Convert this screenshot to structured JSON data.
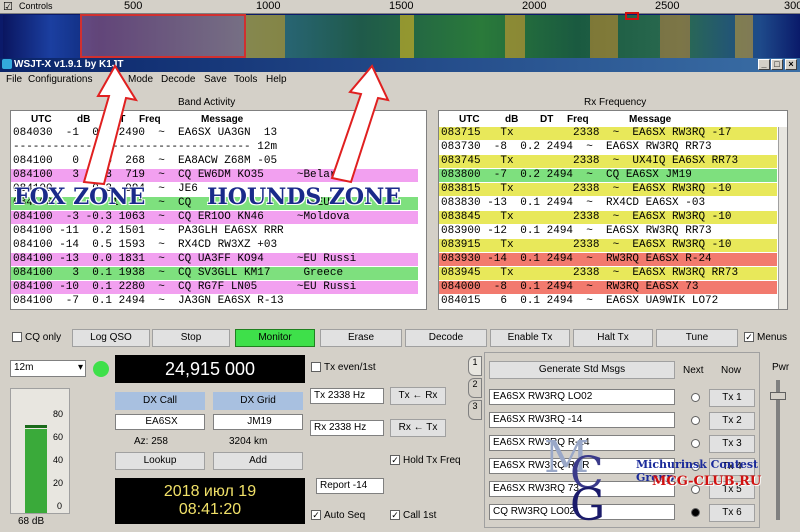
{
  "waterfall": {
    "controls_label": "Controls",
    "ticks": [
      "500",
      "1000",
      "1500",
      "2000",
      "2500",
      "300"
    ]
  },
  "window": {
    "title": "WSJT-X  v1.9.1   by K1JT"
  },
  "menu": [
    "File",
    "Configurations",
    "Mode",
    "Decode",
    "Save",
    "Tools",
    "Help"
  ],
  "band_activity": {
    "title": "Band Activity",
    "headers": {
      "utc": "UTC",
      "db": "dB",
      "dt": "DT",
      "freq": "Freq",
      "message": "Message"
    },
    "rows": [
      {
        "text": "084030  -1  0.2 2490  ~  EA6SX UA3GN  13",
        "color": "none"
      },
      {
        "text": "------------------------------------ 12m",
        "color": "none"
      },
      {
        "text": "084100   0  0.6  268  ~  EA8ACW Z68M -05",
        "color": "none"
      },
      {
        "text": "084100   3  0.3  719  ~  CQ EW6DM KO35     ~Belarus",
        "color": "pink"
      },
      {
        "text": "084100      0.3  994  ~  JE6",
        "color": "none"
      },
      {
        "text": "084100         1   1  ~  CQ                  ~EU",
        "color": "green"
      },
      {
        "text": "084100  -3 -0.3 1063  ~  CQ ER1OO KN46     ~Moldova",
        "color": "pink"
      },
      {
        "text": "084100 -11  0.2 1501  ~  PA3GLH EA6SX RRR",
        "color": "none"
      },
      {
        "text": "084100 -14  0.5 1593  ~  RX4CD RW3XZ +03",
        "color": "none"
      },
      {
        "text": "084100 -13  0.0 1831  ~  CQ UA3FF KO94     ~EU Russi",
        "color": "pink"
      },
      {
        "text": "084100   3  0.1 1938  ~  CQ SV3GLL KM17     Greece",
        "color": "green"
      },
      {
        "text": "084100 -10  0.1 2280  ~  CQ RG7F LN05      ~EU Russi",
        "color": "pink"
      },
      {
        "text": "084100  -7  0.1 2494  ~  JA3GN EA6SX R-13",
        "color": "none"
      }
    ]
  },
  "rx_frequency": {
    "title": "Rx Frequency",
    "headers": {
      "utc": "UTC",
      "db": "dB",
      "dt": "DT",
      "freq": "Freq",
      "message": "Message"
    },
    "rows": [
      {
        "text": "083715   Tx         2338  ~  EA6SX RW3RQ -17",
        "color": "yellow"
      },
      {
        "text": "083730  -8  0.2 2494  ~  EA6SX RW3RQ RR73",
        "color": "none"
      },
      {
        "text": "083745   Tx         2338  ~  UX4IQ EA6SX RR73",
        "color": "yellow"
      },
      {
        "text": "083800  -7  0.2 2494  ~  CQ EA6SX JM19",
        "color": "green"
      },
      {
        "text": "083815   Tx         2338  ~  EA6SX RW3RQ -10",
        "color": "yellow"
      },
      {
        "text": "083830 -13  0.1 2494  ~  RX4CD EA6SX -03",
        "color": "none"
      },
      {
        "text": "083845   Tx         2338  ~  EA6SX RW3RQ -10",
        "color": "yellow"
      },
      {
        "text": "083900 -12  0.1 2494  ~  EA6SX RW3RQ RR73",
        "color": "none"
      },
      {
        "text": "083915   Tx         2338  ~  EA6SX RW3RQ -10",
        "color": "yellow"
      },
      {
        "text": "083930 -14  0.1 2494  ~  RW3RQ EA6SX R-24",
        "color": "red"
      },
      {
        "text": "083945   Tx         2338  ~  EA6SX RW3RQ RR73",
        "color": "yellow"
      },
      {
        "text": "084000  -8  0.1 2494  ~  RW3RQ EA6SX 73",
        "color": "red"
      },
      {
        "text": "084015   6  0.1 2494  ~  EA6SX UA9WIK LO72",
        "color": "none"
      }
    ]
  },
  "controls": {
    "cq_only": "CQ only",
    "log_qso": "Log QSO",
    "stop": "Stop",
    "monitor": "Monitor",
    "erase": "Erase",
    "decode": "Decode",
    "enable_tx": "Enable Tx",
    "halt_tx": "Halt Tx",
    "tune": "Tune",
    "menus": "Menus"
  },
  "band": "12m",
  "frequency": "24,915 000",
  "tx_even": "Tx even/1st",
  "dx_call_label": "DX Call",
  "dx_grid_label": "DX Grid",
  "dx_call": "EA6SX",
  "dx_grid": "JM19",
  "az": "Az: 258",
  "dist": "3204 km",
  "lookup": "Lookup",
  "add": "Add",
  "date": "2018 июл 19",
  "time": "08:41:20",
  "db_level": "68 dB",
  "meter_ticks": [
    "80",
    "60",
    "40",
    "20",
    "0"
  ],
  "tx_hz": "Tx  2338  Hz",
  "rx_hz": "Rx  2338  Hz",
  "tx_from_rx": "Tx ← Rx",
  "rx_from_tx": "Rx ← Tx",
  "hold_tx": "Hold Tx Freq",
  "report": "Report -14",
  "auto_seq": "Auto Seq",
  "call_1st": "Call 1st",
  "tabs": [
    "1",
    "2",
    "3"
  ],
  "gen_std": "Generate Std Msgs",
  "next": "Next",
  "now": "Now",
  "tx_msgs": [
    "EA6SX RW3RQ LO02",
    "EA6SX RW3RQ -14",
    "EA6SX RW3RQ R-14",
    "EA6SX RW3RQ RRR",
    "EA6SX RW3RQ 73",
    "CQ RW3RQ LO02"
  ],
  "tx_buttons": [
    "Tx 1",
    "Tx 2",
    "Tx 3",
    "Tx 4",
    "Tx 5",
    "Tx 6"
  ],
  "pwr": "Pwr",
  "overlay": {
    "fox": "FOX ZONE",
    "hounds": "HOUNDS ZONE",
    "group": "Michurinsk Contest Group",
    "site": "MCG-CLUB.RU",
    "logo_m": "M",
    "logo_c": "C",
    "logo_g": "G"
  },
  "colors": {
    "pink": "#f2a0f0",
    "green": "#7ee07e",
    "yellow": "#e8e85a",
    "red": "#f27a6e",
    "monitor": "#3ee04a",
    "arrow": "#e02020"
  }
}
